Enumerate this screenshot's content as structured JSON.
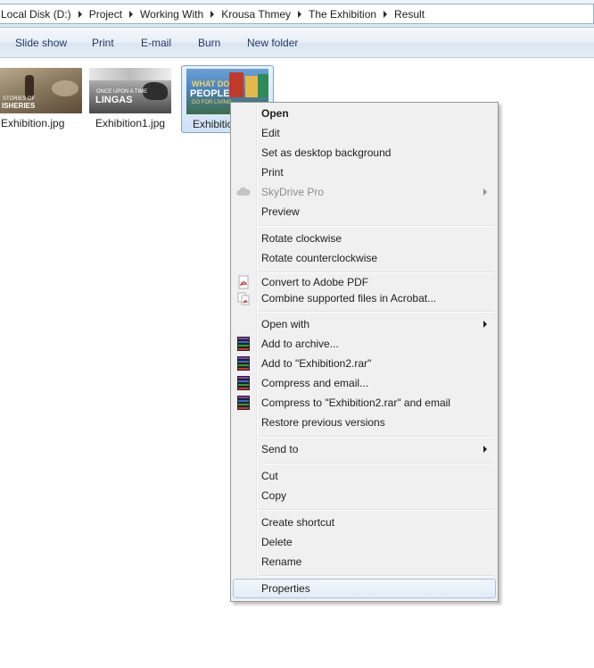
{
  "breadcrumb": [
    "Local Disk (D:)",
    "Project",
    "Working With",
    "Krousa Thmey",
    "The Exhibition",
    "Result"
  ],
  "toolbar": {
    "slideshow": "Slide show",
    "print": "Print",
    "email": "E-mail",
    "burn": "Burn",
    "new_folder": "New folder"
  },
  "files": [
    {
      "name": "Exhibition.jpg",
      "thumb_text": "STORIES OF",
      "thumb_text2": "ISHERIES"
    },
    {
      "name": "Exhibition1.jpg",
      "thumb_text": "ONCE UPON A TIME",
      "thumb_text2": "LINGAS"
    },
    {
      "name": "Exhibition",
      "thumb_text": "WHAT DO",
      "thumb_text2": "PEOPLE",
      "thumb_text3": "DO FOR LIVING"
    }
  ],
  "menu": {
    "open": "Open",
    "edit": "Edit",
    "set_bg": "Set as desktop background",
    "print": "Print",
    "skydrive": "SkyDrive Pro",
    "preview": "Preview",
    "rotate_cw": "Rotate clockwise",
    "rotate_ccw": "Rotate counterclockwise",
    "convert_pdf": "Convert to Adobe PDF",
    "combine_acrobat": "Combine supported files in Acrobat...",
    "open_with": "Open with",
    "add_archive": "Add to archive...",
    "add_rar": "Add to \"Exhibition2.rar\"",
    "compress_email": "Compress and email...",
    "compress_rar_email": "Compress to \"Exhibition2.rar\" and email",
    "restore": "Restore previous versions",
    "send_to": "Send to",
    "cut": "Cut",
    "copy": "Copy",
    "create_shortcut": "Create shortcut",
    "delete": "Delete",
    "rename": "Rename",
    "properties": "Properties"
  },
  "icons": {
    "pdf": "adobe-pdf-icon",
    "acrobat": "acrobat-combine-icon",
    "rar": "winrar-icon",
    "skydrive": "skydrive-cloud-icon"
  },
  "colors": {
    "selection_border": "#7da2ce",
    "menu_bg": "#f0f0f0",
    "hover_border": "#a9c3e3",
    "toolbar_text": "#1e3a5f"
  }
}
